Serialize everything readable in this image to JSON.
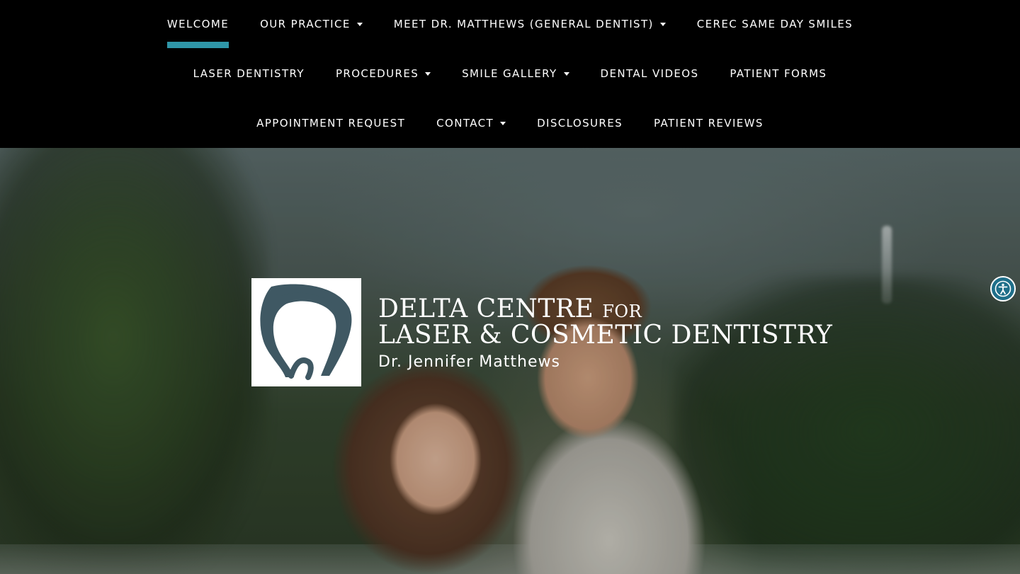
{
  "nav": {
    "row1": [
      {
        "label": "WELCOME",
        "active": true,
        "caret": false
      },
      {
        "label": "OUR PRACTICE",
        "caret": true
      },
      {
        "label": "MEET DR. MATTHEWS (GENERAL DENTIST)",
        "caret": true
      },
      {
        "label": "CEREC SAME DAY SMILES",
        "caret": false
      }
    ],
    "row2": [
      {
        "label": "LASER DENTISTRY",
        "caret": false
      },
      {
        "label": "PROCEDURES",
        "caret": true
      },
      {
        "label": "SMILE GALLERY",
        "caret": true
      },
      {
        "label": "DENTAL VIDEOS",
        "caret": false
      },
      {
        "label": "PATIENT FORMS",
        "caret": false
      }
    ],
    "row3": [
      {
        "label": "APPOINTMENT REQUEST",
        "caret": false
      },
      {
        "label": "CONTACT",
        "caret": true
      },
      {
        "label": "DISCLOSURES",
        "caret": false
      },
      {
        "label": "PATIENT REVIEWS",
        "caret": false
      }
    ],
    "active_color": "#2f96a8"
  },
  "logo": {
    "line1_main": "DELTA CENTRE",
    "line1_small": "FOR",
    "line2": "LASER & COSMETIC DENTISTRY",
    "line3": "Dr. Jennifer Matthews",
    "mark_icon": "tooth-icon",
    "mark_color": "#3f5863"
  },
  "accessibility": {
    "icon": "accessibility-icon",
    "color": "#1f6f8a"
  }
}
